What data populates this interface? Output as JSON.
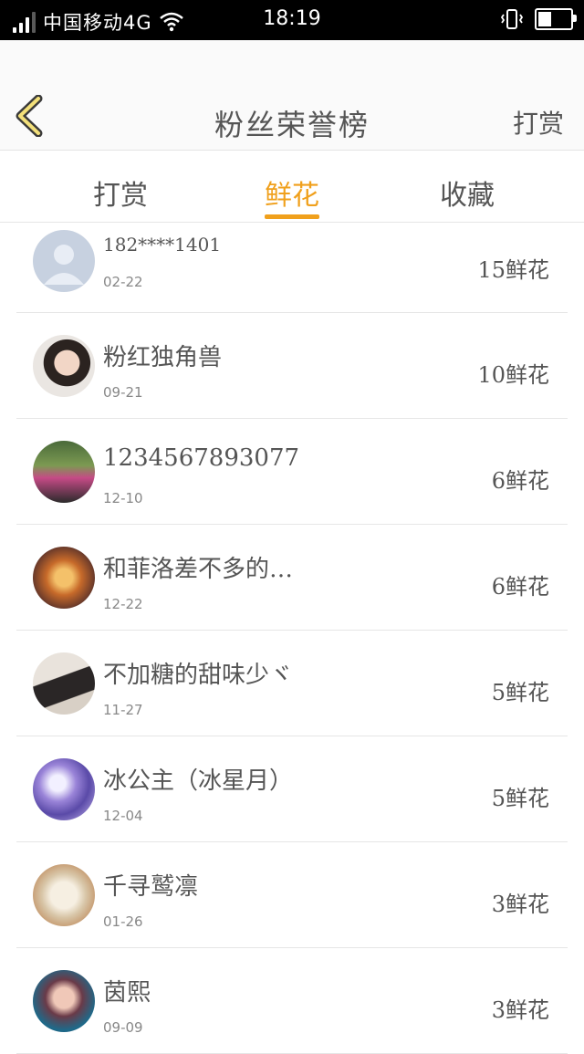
{
  "status_bar": {
    "carrier": "中国移动4G",
    "time": "18:19"
  },
  "header": {
    "title": "粉丝荣誉榜",
    "action_label": "打赏"
  },
  "tabs": [
    {
      "label": "打赏",
      "active": false
    },
    {
      "label": "鲜花",
      "active": true
    },
    {
      "label": "收藏",
      "active": false
    }
  ],
  "accent_color": "#f0a01c",
  "fans": [
    {
      "name": "182****1401",
      "date": "02-22",
      "count": "15鲜花"
    },
    {
      "name": "粉红独角兽",
      "date": "09-21",
      "count": "10鲜花"
    },
    {
      "name": "1234567893077",
      "date": "12-10",
      "count": "6鲜花"
    },
    {
      "name": "和菲洛差不多的…",
      "date": "12-22",
      "count": "6鲜花"
    },
    {
      "name": "不加糖的甜味少ヾ",
      "date": "11-27",
      "count": "5鲜花"
    },
    {
      "name": "冰公主（冰星月）",
      "date": "12-04",
      "count": "5鲜花"
    },
    {
      "name": "千寻鹫凛",
      "date": "01-26",
      "count": "3鲜花"
    },
    {
      "name": "茵熙",
      "date": "09-09",
      "count": "3鲜花"
    }
  ]
}
